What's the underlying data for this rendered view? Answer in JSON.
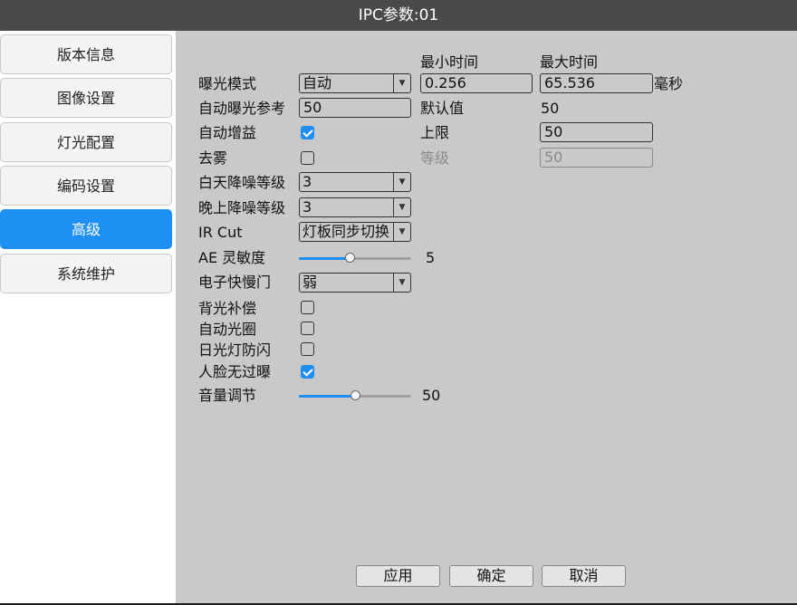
{
  "window": {
    "title": "IPC参数:01"
  },
  "sidebar": {
    "items": [
      {
        "label": "版本信息"
      },
      {
        "label": "图像设置"
      },
      {
        "label": "灯光配置"
      },
      {
        "label": "编码设置"
      },
      {
        "label": "高级",
        "active": true
      },
      {
        "label": "系统维护"
      }
    ]
  },
  "form": {
    "header_min": "最小时间",
    "header_max": "最大时间",
    "exposure_mode": {
      "label": "曝光模式",
      "value": "自动",
      "min_value": "0.256",
      "max_value": "65.536",
      "unit": "毫秒"
    },
    "auto_exposure_ref": {
      "label": "自动曝光参考",
      "value": "50",
      "default_label": "默认值",
      "default_value": "50"
    },
    "auto_gain": {
      "label": "自动增益",
      "checked": true,
      "limit_label": "上限",
      "limit_value": "50"
    },
    "defog": {
      "label": "去雾",
      "checked": false,
      "level_label": "等级",
      "level_value": "50"
    },
    "day_nr": {
      "label": "白天降噪等级",
      "value": "3"
    },
    "night_nr": {
      "label": "晚上降噪等级",
      "value": "3"
    },
    "ir_cut": {
      "label": "IR Cut",
      "value": "灯板同步切换"
    },
    "ae_sensitivity": {
      "label": "AE 灵敏度",
      "value": "5",
      "fraction": 0.45
    },
    "electronic_shutter": {
      "label": "电子快慢门",
      "value": "弱"
    },
    "backlight_comp": {
      "label": "背光补偿",
      "checked": false
    },
    "auto_iris": {
      "label": "自动光圈",
      "checked": false
    },
    "anti_flicker": {
      "label": "日光灯防闪",
      "checked": false
    },
    "face_no_overexposure": {
      "label": "人脸无过曝",
      "checked": true
    },
    "volume": {
      "label": "音量调节",
      "value": "50",
      "fraction": 0.5
    }
  },
  "buttons": {
    "apply": "应用",
    "ok": "确定",
    "cancel": "取消"
  },
  "colors": {
    "accent": "#1e90f4",
    "panel": "#c9c9c9",
    "titlebar": "#4a4a4a"
  }
}
